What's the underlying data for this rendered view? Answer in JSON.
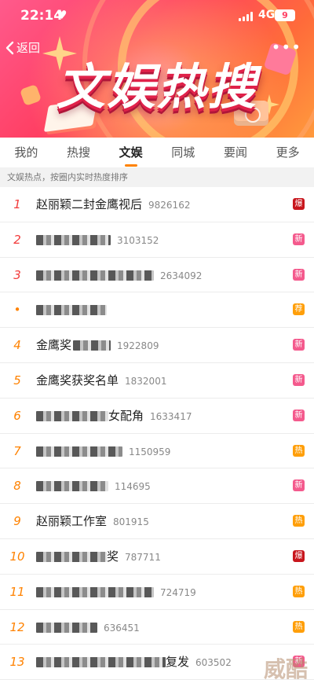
{
  "status": {
    "time": "22:14",
    "network": "4G",
    "battery": "9"
  },
  "nav": {
    "back_label": "返回"
  },
  "hero": {
    "title": "文娱热搜"
  },
  "tabs": [
    {
      "label": "我的",
      "active": false
    },
    {
      "label": "热搜",
      "active": false
    },
    {
      "label": "文娱",
      "active": true
    },
    {
      "label": "同城",
      "active": false
    },
    {
      "label": "要闻",
      "active": false
    },
    {
      "label": "更多",
      "active": false
    }
  ],
  "subheader": "文娱热点，按圈内实时热度排序",
  "colors": {
    "new": "#f45a8d",
    "hot": "#ff9f0a",
    "boom": "#c8161d",
    "rank_top": "#f23b3b",
    "rank_normal": "#ff8200",
    "tab_indicator": "#ff8200"
  },
  "list": [
    {
      "rank": "1",
      "title": "赵丽颖二封金鹰视后",
      "count": "9826162",
      "badge": "爆",
      "badge_type": "boom",
      "blur_before": 0,
      "blur_after": 0
    },
    {
      "rank": "2",
      "title": "",
      "count": "3103152",
      "badge": "新",
      "badge_type": "new",
      "blur_before": 95,
      "blur_after": 0
    },
    {
      "rank": "3",
      "title": "",
      "count": "2634092",
      "badge": "新",
      "badge_type": "new",
      "blur_before": 150,
      "blur_after": 0
    },
    {
      "rank": "•",
      "title": "",
      "count": "",
      "badge": "荐",
      "badge_type": "hot",
      "blur_before": 90,
      "blur_after": 0
    },
    {
      "rank": "4",
      "title": "金鹰奖",
      "count": "1922809",
      "badge": "新",
      "badge_type": "new",
      "blur_before": 0,
      "blur_after": 48
    },
    {
      "rank": "5",
      "title": "金鹰奖获奖名单",
      "count": "1832001",
      "badge": "新",
      "badge_type": "new",
      "blur_before": 0,
      "blur_after": 0
    },
    {
      "rank": "6",
      "title": "女配角",
      "count": "1633417",
      "badge": "新",
      "badge_type": "new",
      "blur_before": 92,
      "blur_after": 0
    },
    {
      "rank": "7",
      "title": "",
      "count": "1150959",
      "badge": "热",
      "badge_type": "hot",
      "blur_before": 110,
      "blur_after": 0
    },
    {
      "rank": "8",
      "title": "",
      "count": "114695",
      "badge": "新",
      "badge_type": "new",
      "blur_before": 92,
      "blur_after": 0
    },
    {
      "rank": "9",
      "title": "赵丽颖工作室",
      "count": "801915",
      "badge": "热",
      "badge_type": "hot",
      "blur_before": 0,
      "blur_after": 0
    },
    {
      "rank": "10",
      "title": "奖",
      "count": "787711",
      "badge": "爆",
      "badge_type": "boom",
      "blur_before": 90,
      "blur_after": 0
    },
    {
      "rank": "11",
      "title": "",
      "count": "724719",
      "badge": "热",
      "badge_type": "hot",
      "blur_before": 150,
      "blur_after": 0
    },
    {
      "rank": "12",
      "title": "",
      "count": "636451",
      "badge": "热",
      "badge_type": "hot",
      "blur_before": 78,
      "blur_after": 0
    },
    {
      "rank": "13",
      "title": "复发",
      "count": "603502",
      "badge": "新",
      "badge_type": "new",
      "blur_before": 165,
      "blur_after": 0
    }
  ],
  "watermark": "威酷"
}
